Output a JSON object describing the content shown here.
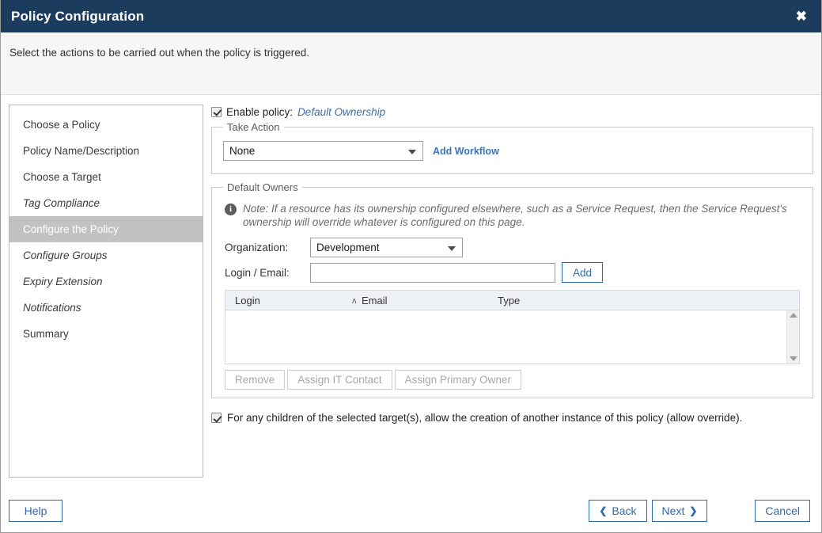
{
  "window": {
    "title": "Policy Configuration",
    "close_icon": "close-icon",
    "close_glyph": "✖"
  },
  "description": "Select the actions to be carried out when the policy is triggered.",
  "sidebar": {
    "items": [
      {
        "label": "Choose a Policy",
        "style": "normal",
        "selected": false
      },
      {
        "label": "Policy Name/Description",
        "style": "normal",
        "selected": false
      },
      {
        "label": "Choose a Target",
        "style": "normal",
        "selected": false
      },
      {
        "label": "Tag Compliance",
        "style": "italic",
        "selected": false
      },
      {
        "label": "Configure the Policy",
        "style": "normal",
        "selected": true
      },
      {
        "label": "Configure Groups",
        "style": "italic",
        "selected": false
      },
      {
        "label": "Expiry Extension",
        "style": "italic",
        "selected": false
      },
      {
        "label": "Notifications",
        "style": "italic",
        "selected": false
      },
      {
        "label": "Summary",
        "style": "normal",
        "selected": false
      }
    ]
  },
  "main": {
    "enable_policy": {
      "label": "Enable policy:",
      "value": "Default Ownership",
      "checked": true
    },
    "take_action": {
      "legend": "Take Action",
      "selected": "None",
      "options": [
        "None"
      ],
      "add_workflow_link": "Add Workflow"
    },
    "default_owners": {
      "legend": "Default Owners",
      "note": "Note: If a resource has its ownership configured elsewhere, such as a Service Request, then the Service Request's ownership will override whatever is configured on this page.",
      "note_icon": "info-icon",
      "organization": {
        "label": "Organization:",
        "selected": "Development",
        "options": [
          "Development"
        ]
      },
      "login_email": {
        "label": "Login / Email:",
        "value": "",
        "placeholder": "",
        "add_button": "Add"
      },
      "grid": {
        "columns": [
          "Login",
          "Email",
          "Type"
        ],
        "sort_column": "Login",
        "sort_direction": "ascending",
        "sort_glyph": "ʌ",
        "rows": []
      },
      "grid_buttons": [
        {
          "label": "Remove",
          "enabled": false
        },
        {
          "label": "Assign IT Contact",
          "enabled": false
        },
        {
          "label": "Assign Primary Owner",
          "enabled": false
        }
      ]
    },
    "override": {
      "checked": true,
      "label": "For any children of the selected target(s), allow the creation of another instance of this policy (allow override)."
    }
  },
  "footer": {
    "help": "Help",
    "back": "Back",
    "back_chevron": "❮",
    "next": "Next",
    "next_chevron": "❯",
    "cancel": "Cancel"
  },
  "colors": {
    "titlebar": "#1c3c5e",
    "accent_link": "#3d74b8",
    "button_blue": "#2f6aab",
    "selected_item": "#c2c2c2",
    "grid_header": "#eef2f6"
  }
}
